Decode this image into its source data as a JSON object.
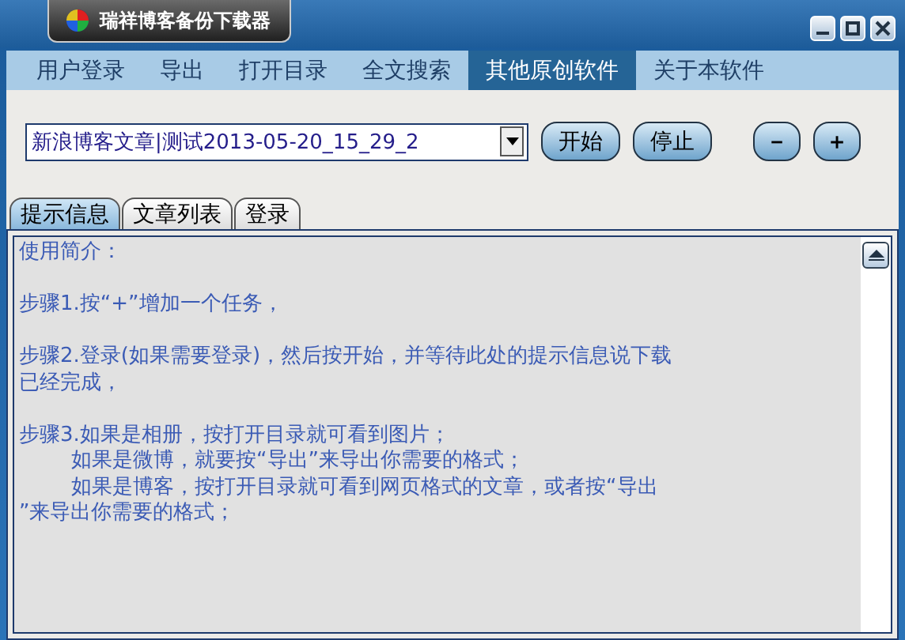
{
  "window": {
    "title": "瑞祥博客备份下载器"
  },
  "menu": [
    {
      "label": "用户登录",
      "selected": false
    },
    {
      "label": "导出",
      "selected": false
    },
    {
      "label": "打开目录",
      "selected": false
    },
    {
      "label": "全文搜索",
      "selected": false
    },
    {
      "label": "其他原创软件",
      "selected": true
    },
    {
      "label": "关于本软件",
      "selected": false
    }
  ],
  "task_select": {
    "value": "新浪博客文章|测试2013-05-20_15_29_2"
  },
  "buttons": [
    "开始",
    "停止"
  ],
  "task_buttons": [
    "－",
    "＋"
  ],
  "tabs": [
    {
      "label": "提示信息",
      "selected": true
    },
    {
      "label": "文章列表",
      "selected": false
    },
    {
      "label": "登录",
      "selected": false
    }
  ],
  "info_paragraphs": [
    [
      "使用简介："
    ],
    [
      "步骤1.按“+”增加一个任务，"
    ],
    [
      "步骤2.登录(如果需要登录)，然后按开始，并等待此处的提示信息说下载",
      "已经完成，"
    ],
    [
      "步骤3.如果是相册，按打开目录就可看到图片；",
      "        如果是微博，就要按“导出”来导出你需要的格式；",
      "        如果是博客，按打开目录就可看到网页格式的文章，或者按“导出",
      "”来导出你需要的格式；"
    ]
  ]
}
